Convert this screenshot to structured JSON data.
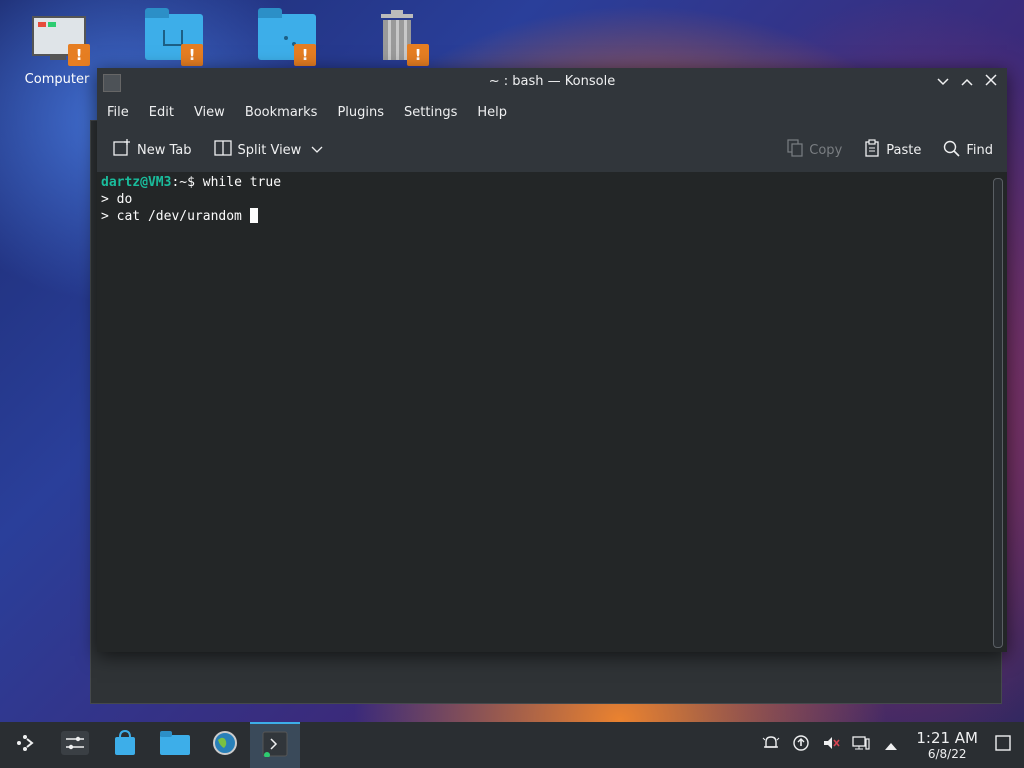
{
  "desktop": {
    "icons": [
      {
        "label": "Computer",
        "name": "computer-icon"
      },
      {
        "label": "",
        "name": "home-folder-icon"
      },
      {
        "label": "",
        "name": "network-folder-icon"
      },
      {
        "label": "",
        "name": "trash-icon"
      }
    ],
    "warning_glyph": "!"
  },
  "window": {
    "title": "~ : bash — Konsole",
    "menu": [
      "File",
      "Edit",
      "View",
      "Bookmarks",
      "Plugins",
      "Settings",
      "Help"
    ],
    "toolbar": {
      "new_tab": "New Tab",
      "split_view": "Split View",
      "copy": "Copy",
      "paste": "Paste",
      "find": "Find"
    }
  },
  "terminal": {
    "user_host": "dartz@VM3",
    "prompt_tail": ":~$ ",
    "command": "while true",
    "lines": [
      "> do",
      "> cat /dev/urandom "
    ]
  },
  "taskbar": {
    "clock_time": "1:21 AM",
    "clock_date": "6/8/22"
  },
  "colors": {
    "accent": "#3daee9",
    "prompt": "#1abc9c",
    "warning": "#e67e22"
  }
}
